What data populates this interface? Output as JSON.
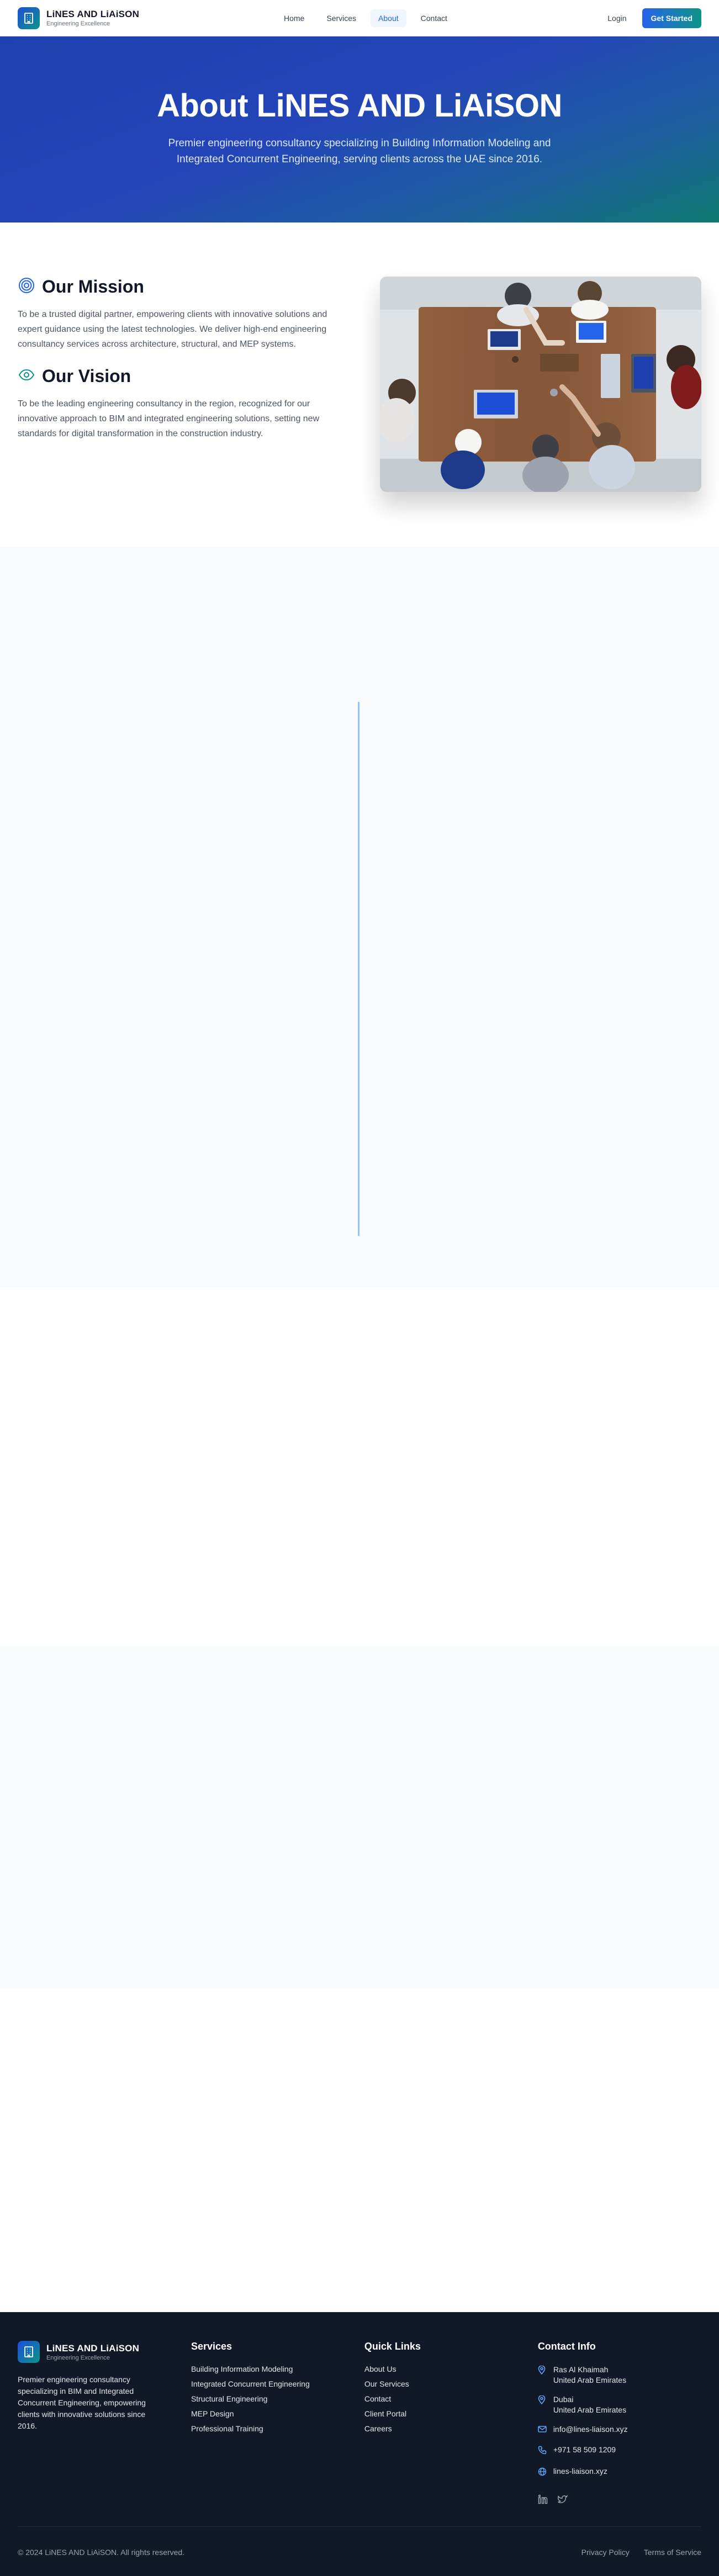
{
  "brand": {
    "name": "LiNES AND LiAiSON",
    "tagline": "Engineering Excellence"
  },
  "nav": {
    "links": [
      "Home",
      "Services",
      "About",
      "Contact"
    ],
    "active": "About",
    "login": "Login",
    "cta": "Get Started"
  },
  "hero": {
    "title": "About LiNES AND LiAiSON",
    "subtitle": "Premier engineering consultancy specializing in Building Information Modeling and Integrated Concurrent Engineering, serving clients across the UAE since 2016."
  },
  "mission": {
    "title": "Our Mission",
    "text": "To be a trusted digital partner, empowering clients with innovative solutions and expert guidance using the latest technologies. We deliver high-end engineering consultancy services across architecture, structural, and MEP systems."
  },
  "vision": {
    "title": "Our Vision",
    "text": "To be the leading engineering consultancy in the region, recognized for our innovative approach to BIM and integrated engineering solutions, setting new standards for digital transformation in the construction industry."
  },
  "footer": {
    "brand_name": "LiNES AND LiAiSON",
    "brand_tagline": "Engineering Excellence",
    "description": "Premier engineering consultancy specializing in BIM and Integrated Concurrent Engineering, empowering clients with innovative solutions since 2016.",
    "services_title": "Services",
    "services": [
      "Building Information Modeling",
      "Integrated Concurrent Engineering",
      "Structural Engineering",
      "MEP Design",
      "Professional Training"
    ],
    "quick_title": "Quick Links",
    "quick_links": [
      "About Us",
      "Our Services",
      "Contact",
      "Client Portal",
      "Careers"
    ],
    "contact_title": "Contact Info",
    "contact": {
      "office1_city": "Ras Al Khaimah",
      "office1_country": "United Arab Emirates",
      "office2_city": "Dubai",
      "office2_country": "United Arab Emirates",
      "email": "info@lines-liaison.xyz",
      "phone": "+971 58 509 1209",
      "website": "lines-liaison.xyz"
    },
    "copyright": "© 2024 LiNES AND LiAiSON. All rights reserved.",
    "privacy": "Privacy Policy",
    "terms": "Terms of Service"
  },
  "colors": {
    "primary": "#2563eb",
    "accent_teal": "#0d9488",
    "footer_bg": "#111827",
    "timeline": "#93c5fd"
  },
  "icons": {
    "logo": "building-icon",
    "mission": "target-icon",
    "vision": "eye-icon",
    "location": "map-pin-icon",
    "email": "mail-icon",
    "phone": "phone-icon",
    "website": "globe-icon",
    "social": [
      "linkedin-icon",
      "twitter-icon"
    ]
  }
}
